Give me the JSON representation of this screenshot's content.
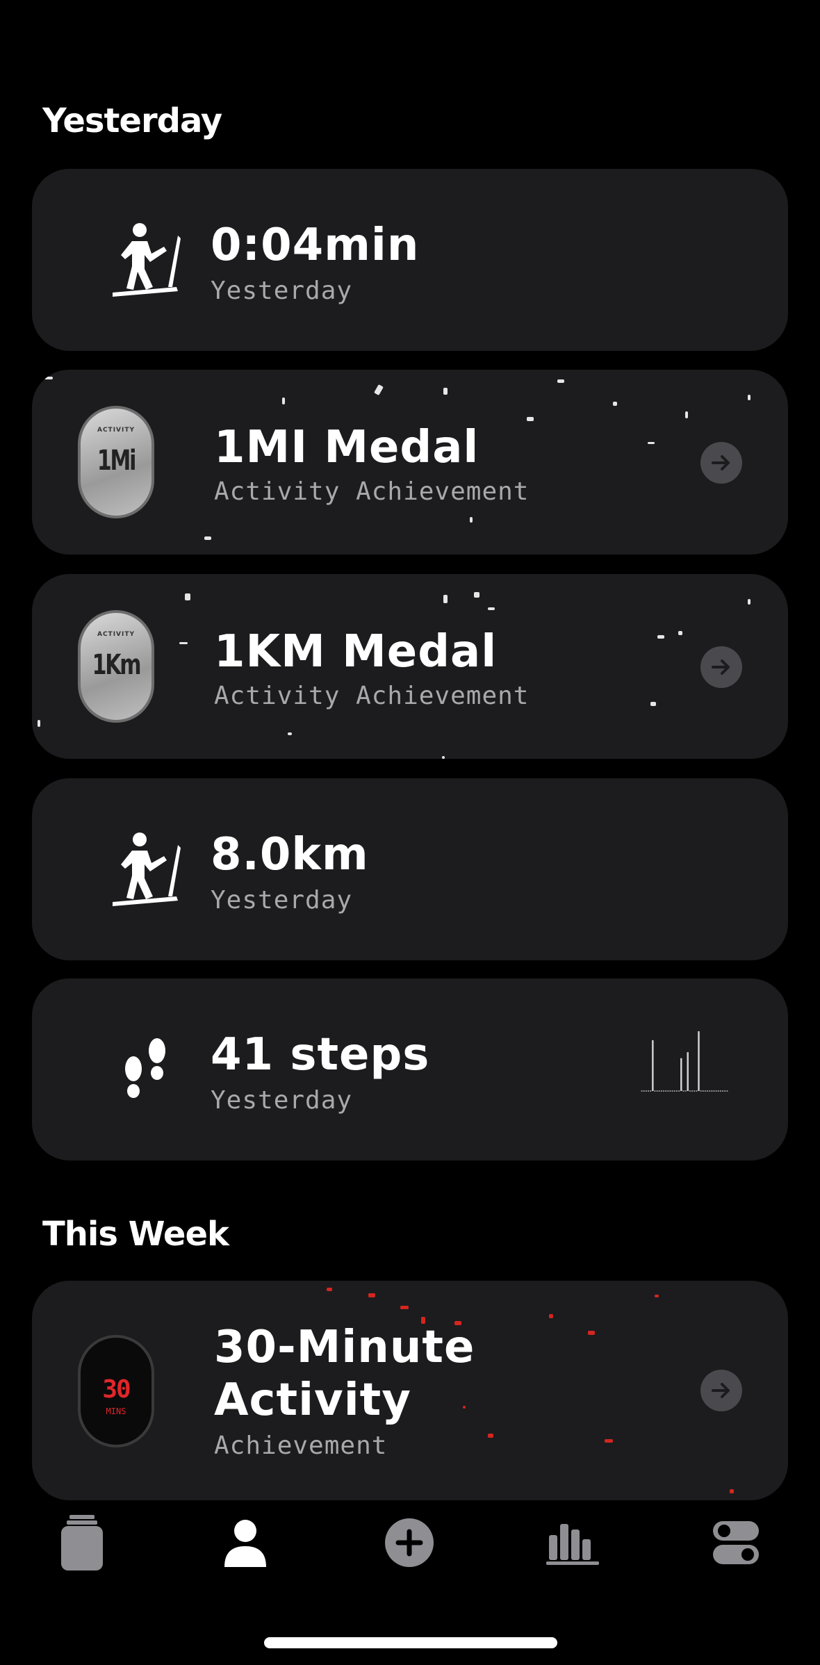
{
  "sections": {
    "yesterday": "Yesterday",
    "this_week": "This Week"
  },
  "cards": {
    "duration": {
      "title": "0:04min",
      "subtitle": "Yesterday",
      "icon": "treadmill-icon"
    },
    "medal_1mi": {
      "title": "1MI Medal",
      "subtitle": "Activity Achievement",
      "badge_top": "ACTIVITY",
      "badge_text": "1Mi",
      "icon": "medal-badge"
    },
    "medal_1km": {
      "title": "1KM Medal",
      "subtitle": "Activity Achievement",
      "badge_top": "ACTIVITY",
      "badge_text": "1Km",
      "icon": "medal-badge"
    },
    "distance": {
      "title": "8.0km",
      "subtitle": "Yesterday",
      "icon": "treadmill-icon"
    },
    "steps": {
      "title": "41 steps",
      "subtitle": "Yesterday",
      "icon": "footprints-icon",
      "sparkline": [
        0,
        0,
        0,
        0,
        0,
        0.85,
        0,
        0,
        0,
        0,
        0,
        0,
        0,
        0,
        0,
        0,
        0,
        0,
        0.55,
        0,
        0,
        0.65,
        0,
        0,
        0,
        0,
        1.0,
        0,
        0,
        0,
        0,
        0,
        0,
        0,
        0,
        0,
        0,
        0,
        0,
        0
      ]
    },
    "thirty_min": {
      "title_line1": "30-Minute",
      "title_line2": "Activity",
      "subtitle": "Achievement",
      "badge_number": "30",
      "badge_unit": "MINS",
      "accent": "#e0262b"
    }
  },
  "tabbar": {
    "items": [
      {
        "name": "tab-journal",
        "icon": "jar-icon",
        "active": false
      },
      {
        "name": "tab-profile",
        "icon": "person-icon",
        "active": true
      },
      {
        "name": "tab-add",
        "icon": "plus-circle-icon",
        "active": false
      },
      {
        "name": "tab-stats",
        "icon": "bar-chart-icon",
        "active": false
      },
      {
        "name": "tab-settings",
        "icon": "toggles-icon",
        "active": false
      }
    ]
  },
  "colors": {
    "background": "#000000",
    "card": "#1c1c1e",
    "subtitle": "#a8a8ad",
    "arrow_button": "#4a4a4e",
    "inactive_tab": "#8e8e93",
    "active_tab": "#ffffff"
  }
}
